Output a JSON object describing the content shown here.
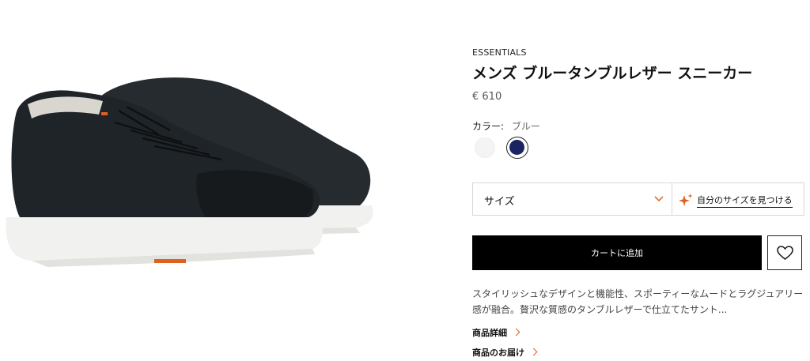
{
  "product": {
    "line": "ESSENTIALS",
    "title": "メンズ ブルータンブルレザー スニーカー",
    "price": "€ 610",
    "color_label": "カラー:",
    "color_value": "ブルー",
    "swatches": [
      {
        "name": "white",
        "color": "#f4f4f4"
      },
      {
        "name": "blue",
        "color": "#1b2461",
        "selected": true
      }
    ],
    "size_label": "サイズ",
    "size_finder": "自分のサイズを見つける",
    "add_to_cart": "カートに追加",
    "description": "スタイリッシュなデザインと機能性、スポーティーなムードとラグジュアリー感が融合。贅沢な質感のタンブルレザーで仕立てたサント...",
    "links": {
      "details": "商品詳細",
      "delivery": "商品のお届け"
    }
  },
  "colors": {
    "accent": "#e0601f",
    "button_bg": "#000000",
    "shoe": "#1f2428",
    "sole": "#f1f1ef"
  }
}
